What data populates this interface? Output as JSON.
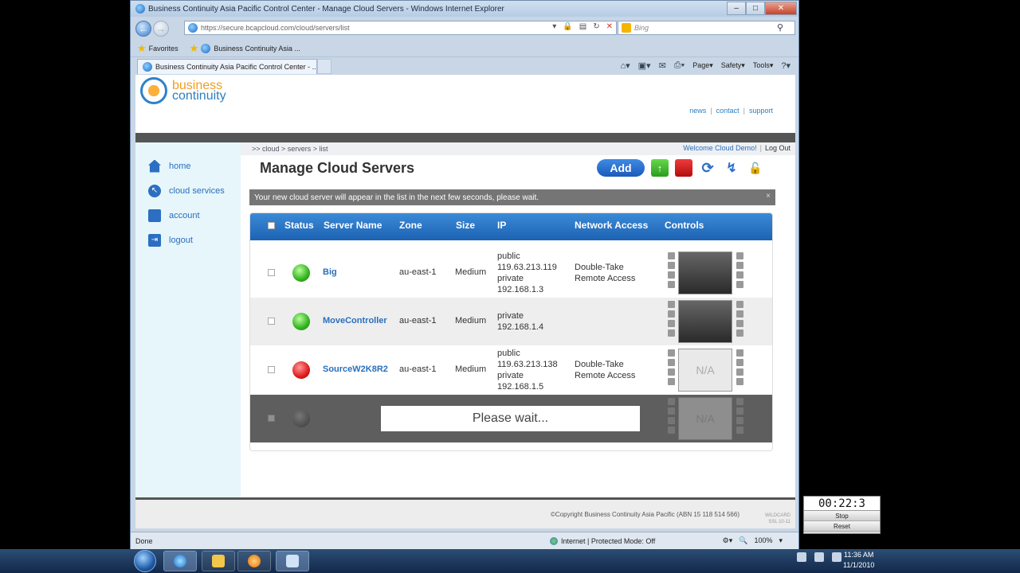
{
  "window": {
    "title": "Business Continuity Asia Pacific Control Center - Manage Cloud Servers - Windows Internet Explorer"
  },
  "address": {
    "url": "https://secure.bcapcloud.com/cloud/servers/list"
  },
  "search": {
    "placeholder": "Bing"
  },
  "favorites": {
    "label": "Favorites",
    "item": "Business Continuity Asia ..."
  },
  "tab": {
    "label": "Business Continuity Asia Pacific Control Center - ..."
  },
  "commandbar": {
    "page": "Page",
    "safety": "Safety",
    "tools": "Tools"
  },
  "logo": {
    "line1": "business",
    "line2": "continuity"
  },
  "toplinks": {
    "news": "news",
    "contact": "contact",
    "support": "support",
    "sep": "|"
  },
  "sidebar": {
    "items": [
      {
        "label": "home",
        "icon": "home-icon"
      },
      {
        "label": "cloud services",
        "icon": "cloud-icon"
      },
      {
        "label": "account",
        "icon": "briefcase-icon"
      },
      {
        "label": "logout",
        "icon": "logout-icon"
      }
    ]
  },
  "breadcrumb": {
    "text": ">> cloud > servers > list"
  },
  "user": {
    "welcome": "Welcome Cloud Demo!",
    "sep": "|",
    "logout": "Log Out"
  },
  "page": {
    "title": "Manage Cloud Servers"
  },
  "actions": {
    "add": "Add"
  },
  "notice": {
    "message": "Your new cloud server will appear in the list in the next few seconds, please wait.",
    "close": "×"
  },
  "table": {
    "headers": {
      "status": "Status",
      "server_name": "Server Name",
      "zone": "Zone",
      "size": "Size",
      "ip": "IP",
      "network_access": "Network Access",
      "controls": "Controls"
    },
    "rows": [
      {
        "status": "green",
        "name": "Big",
        "zone": "au-east-1",
        "size": "Medium",
        "ip_public_label": "public",
        "ip_public": "119.63.213.119",
        "ip_private_label": "private",
        "ip_private": "192.168.1.3",
        "access1": "Double-Take",
        "access2": "Remote Access",
        "thumb": ""
      },
      {
        "status": "green",
        "name": "MoveController",
        "zone": "au-east-1",
        "size": "Medium",
        "ip_public_label": "",
        "ip_public": "",
        "ip_private_label": "private",
        "ip_private": "192.168.1.4",
        "access1": "",
        "access2": "",
        "thumb": ""
      },
      {
        "status": "red",
        "name": "SourceW2K8R2",
        "zone": "au-east-1",
        "size": "Medium",
        "ip_public_label": "public",
        "ip_public": "119.63.213.138",
        "ip_private_label": "private",
        "ip_private": "192.168.1.5",
        "access1": "Double-Take",
        "access2": "Remote Access",
        "thumb": "N/A"
      },
      {
        "status": "gray",
        "name": "",
        "zone": "",
        "size": "",
        "ip_public_label": "",
        "ip_public": "",
        "ip_private_label": "",
        "ip_private": "",
        "access1": "",
        "access2": "",
        "thumb": "N/A",
        "overlay": "Please wait..."
      }
    ]
  },
  "footer": {
    "copyright": "©Copyright Business Continuity Asia Pacific (ABN 15 118 514 566)",
    "badge1": "WILDCARD",
    "badge2": "SSL 10-11"
  },
  "status": {
    "done": "Done",
    "zone": "Internet | Protected Mode: Off",
    "zoom": "100%"
  },
  "stopwatch": {
    "time": "00:22:3",
    "stop": "Stop",
    "reset": "Reset"
  },
  "clock": {
    "time": "11:36 AM",
    "date": "11/1/2010"
  },
  "colors": {
    "accent": "#1d62b2",
    "link": "#2a6fbc",
    "sidebar_bg": "#e6f6fb",
    "notice_bg": "#757575"
  }
}
